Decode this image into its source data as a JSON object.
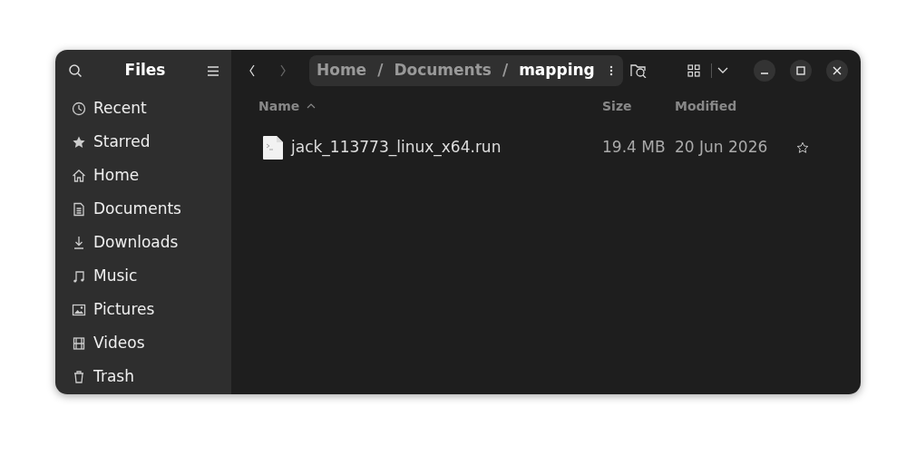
{
  "window": {
    "title": "Files"
  },
  "sidebar": {
    "items": [
      {
        "label": "Recent",
        "kind": "recent",
        "selected": false
      },
      {
        "label": "Starred",
        "kind": "starred",
        "selected": false
      },
      {
        "label": "Home",
        "kind": "home",
        "selected": false
      },
      {
        "label": "Documents",
        "kind": "documents",
        "selected": false
      },
      {
        "label": "Downloads",
        "kind": "downloads",
        "selected": false
      },
      {
        "label": "Music",
        "kind": "music",
        "selected": false
      },
      {
        "label": "Pictures",
        "kind": "pictures",
        "selected": false
      },
      {
        "label": "Videos",
        "kind": "videos",
        "selected": false
      },
      {
        "label": "Trash",
        "kind": "trash",
        "selected": false
      }
    ]
  },
  "breadcrumb": [
    {
      "label": "Home",
      "current": false
    },
    {
      "label": "Documents",
      "current": false
    },
    {
      "label": "mapping",
      "current": true
    }
  ],
  "breadcrumb_separator": "/",
  "table": {
    "columns": [
      {
        "label": "Name",
        "sorted": true
      },
      {
        "label": "Size",
        "sorted": false
      },
      {
        "label": "Modified",
        "sorted": false
      }
    ],
    "rows": [
      {
        "name": "jack_113773_linux_x64.run",
        "size": "19.4 MB",
        "modified": "20 Jun 2026",
        "starred": false,
        "selected": false
      }
    ]
  }
}
